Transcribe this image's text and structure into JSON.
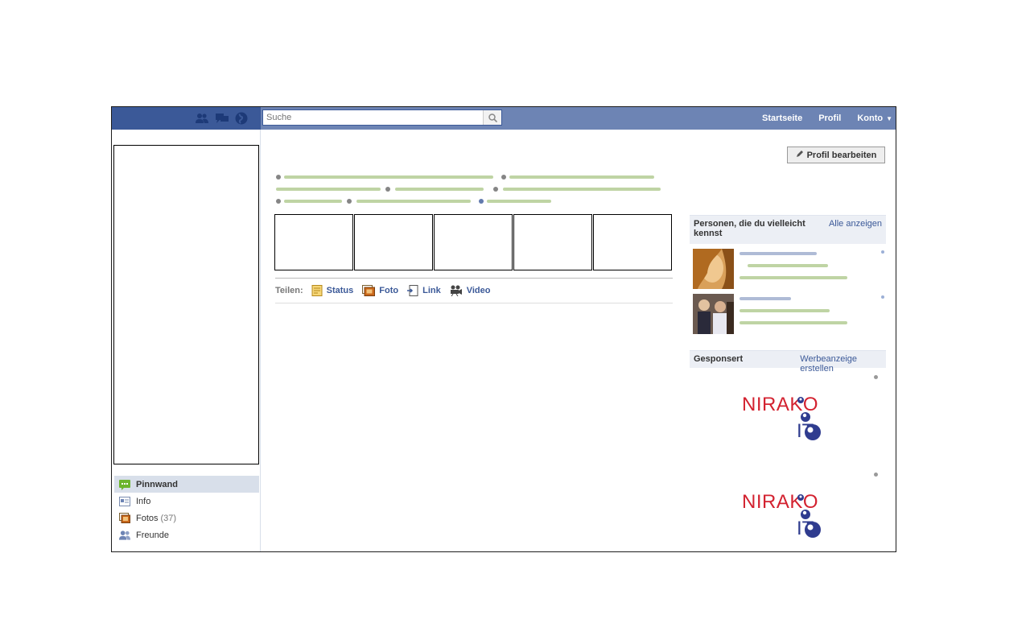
{
  "topbar": {
    "search_placeholder": "Suche",
    "nav": [
      "Startseite",
      "Profil",
      "Konto"
    ]
  },
  "left_nav": [
    {
      "label": "Pinnwand",
      "count": ""
    },
    {
      "label": "Info",
      "count": ""
    },
    {
      "label": "Fotos",
      "count": "(37)"
    },
    {
      "label": "Freunde",
      "count": ""
    }
  ],
  "edit_profile_label": "Profil bearbeiten",
  "share": {
    "label": "Teilen:",
    "options": [
      "Status",
      "Foto",
      "Link",
      "Video"
    ]
  },
  "people_box": {
    "title": "Personen, die du vielleicht kennst",
    "see_all": "Alle anzeigen"
  },
  "sponsored": {
    "title": "Gesponsert",
    "create_ad": "Werbeanzeige erstellen",
    "ads": [
      {
        "brand_top": "NIRAKO",
        "brand_bottom": "IT"
      },
      {
        "brand_top": "NIRAKO",
        "brand_bottom": "IT"
      }
    ]
  },
  "colors": {
    "topbar": "#6d84b4",
    "topbar_dark": "#3b5998",
    "link": "#3b5998",
    "brand_red": "#d32230",
    "brand_blue": "#2f3c8f"
  },
  "icons": [
    "friends-icon",
    "messages-icon",
    "notifications-globe-icon",
    "search-icon",
    "wall-icon",
    "info-icon",
    "photos-icon",
    "friends-nav-icon",
    "pencil-icon",
    "status-icon",
    "photo-icon",
    "link-icon",
    "video-icon"
  ]
}
